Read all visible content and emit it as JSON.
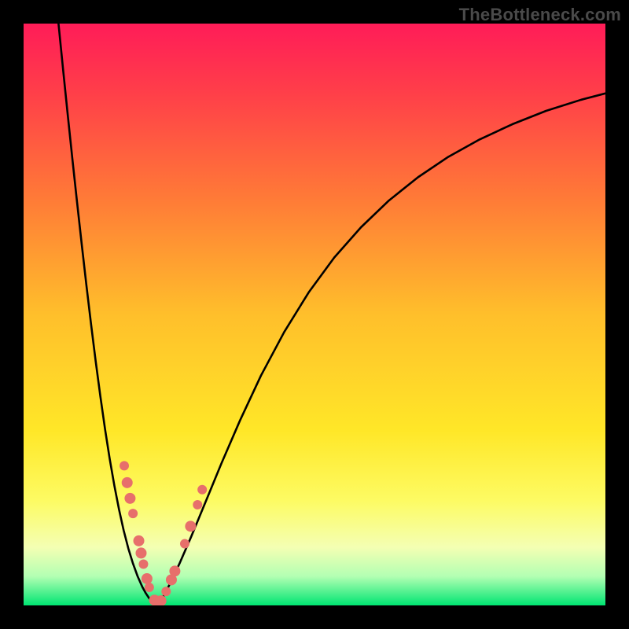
{
  "watermark": "TheBottleneck.com",
  "chart_data": {
    "type": "line",
    "title": "",
    "xlabel": "",
    "ylabel": "",
    "xlim": [
      0,
      100
    ],
    "ylim": [
      0,
      100
    ],
    "background_gradient": {
      "stops": [
        {
          "pos": 0.0,
          "color": "#ff1c58"
        },
        {
          "pos": 0.12,
          "color": "#ff3f49"
        },
        {
          "pos": 0.3,
          "color": "#ff7a37"
        },
        {
          "pos": 0.5,
          "color": "#ffbf2b"
        },
        {
          "pos": 0.7,
          "color": "#ffe728"
        },
        {
          "pos": 0.82,
          "color": "#fdfb63"
        },
        {
          "pos": 0.9,
          "color": "#f4ffb3"
        },
        {
          "pos": 0.95,
          "color": "#b3ffb3"
        },
        {
          "pos": 1.0,
          "color": "#00e572"
        }
      ]
    },
    "series": [
      {
        "name": "left-branch",
        "x": [
          6.0,
          6.8,
          7.6,
          8.4,
          9.2,
          10.0,
          10.8,
          11.6,
          12.4,
          13.2,
          14.0,
          14.8,
          15.6,
          16.4,
          17.2,
          18.0,
          18.8,
          19.6,
          20.4,
          21.0,
          21.6,
          22.0,
          22.4,
          22.7,
          23.0
        ],
        "y": [
          100.0,
          92.0,
          84.2,
          76.6,
          69.2,
          62.0,
          55.0,
          48.3,
          41.9,
          35.9,
          30.3,
          25.2,
          20.6,
          16.5,
          12.9,
          9.8,
          7.2,
          5.0,
          3.2,
          2.1,
          1.2,
          0.7,
          0.3,
          0.1,
          0.0
        ]
      },
      {
        "name": "right-branch",
        "x": [
          23.0,
          24.0,
          25.2,
          26.8,
          28.8,
          31.2,
          34.0,
          37.2,
          40.8,
          44.8,
          49.0,
          53.4,
          58.0,
          62.8,
          67.8,
          73.0,
          78.4,
          84.0,
          89.8,
          95.8,
          100.0
        ],
        "y": [
          0.0,
          1.5,
          3.8,
          7.2,
          11.8,
          17.6,
          24.4,
          31.8,
          39.5,
          47.0,
          53.8,
          59.8,
          65.0,
          69.6,
          73.6,
          77.1,
          80.1,
          82.7,
          85.0,
          86.9,
          88.0
        ]
      }
    ],
    "markers": {
      "name": "data-points",
      "color": "#e76f6b",
      "points": [
        {
          "x": 17.3,
          "y": 24.0,
          "r": 6
        },
        {
          "x": 17.8,
          "y": 21.1,
          "r": 7
        },
        {
          "x": 18.3,
          "y": 18.4,
          "r": 7
        },
        {
          "x": 18.8,
          "y": 15.8,
          "r": 6
        },
        {
          "x": 19.8,
          "y": 11.1,
          "r": 7
        },
        {
          "x": 20.2,
          "y": 9.0,
          "r": 7
        },
        {
          "x": 20.6,
          "y": 7.1,
          "r": 6
        },
        {
          "x": 21.2,
          "y": 4.6,
          "r": 7
        },
        {
          "x": 21.6,
          "y": 3.1,
          "r": 6
        },
        {
          "x": 22.5,
          "y": 0.9,
          "r": 7
        },
        {
          "x": 23.0,
          "y": 0.2,
          "r": 6
        },
        {
          "x": 23.6,
          "y": 0.8,
          "r": 7
        },
        {
          "x": 24.5,
          "y": 2.4,
          "r": 6
        },
        {
          "x": 25.4,
          "y": 4.4,
          "r": 7
        },
        {
          "x": 26.0,
          "y": 5.9,
          "r": 7
        },
        {
          "x": 27.7,
          "y": 10.6,
          "r": 6
        },
        {
          "x": 28.7,
          "y": 13.6,
          "r": 7
        },
        {
          "x": 29.9,
          "y": 17.3,
          "r": 6
        },
        {
          "x": 30.7,
          "y": 19.9,
          "r": 6
        }
      ]
    }
  }
}
